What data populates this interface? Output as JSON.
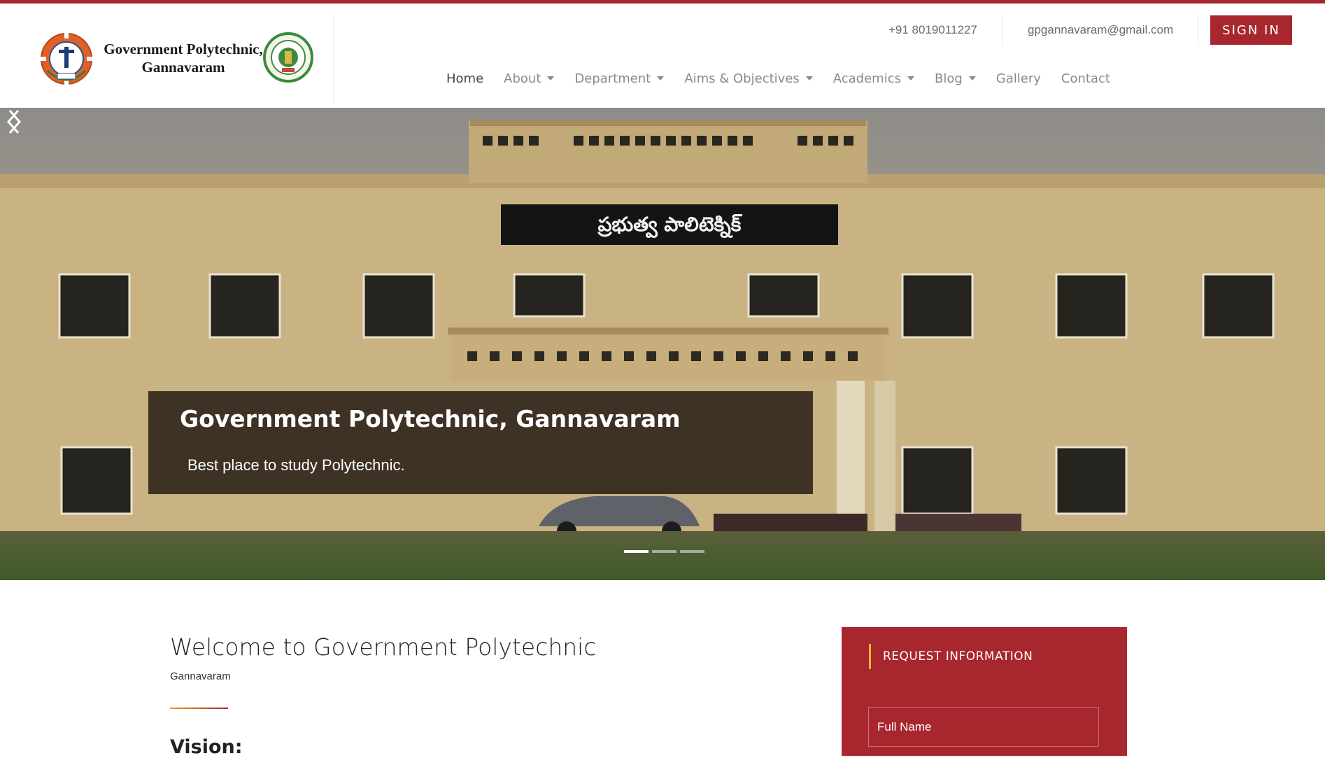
{
  "header": {
    "logo_text_line1": "Government Polytechnic,",
    "logo_text_line2": "Gannavaram",
    "phone": "+91 8019011227",
    "email": "gpgannavaram@gmail.com",
    "signin_label": "SIGN IN"
  },
  "nav": {
    "items": [
      {
        "label": "Home",
        "dropdown": false,
        "active": true
      },
      {
        "label": "About",
        "dropdown": true
      },
      {
        "label": "Department",
        "dropdown": true
      },
      {
        "label": "Aims & Objectives",
        "dropdown": true
      },
      {
        "label": "Academics",
        "dropdown": true
      },
      {
        "label": "Blog",
        "dropdown": true
      },
      {
        "label": "Gallery",
        "dropdown": false
      },
      {
        "label": "Contact",
        "dropdown": false
      }
    ]
  },
  "hero": {
    "building_sign": "ప్రభుత్వ పాలిటెక్నిక్",
    "caption_title": "Government Polytechnic, Gannavaram",
    "caption_subtitle": "Best place to study Polytechnic.",
    "slides_count": 3,
    "active_slide": 1
  },
  "main": {
    "welcome_title": "Welcome to Government Polytechnic",
    "welcome_subtitle": "Gannavaram",
    "vision_heading": "Vision:"
  },
  "request": {
    "title": "REQUEST INFORMATION",
    "full_name_placeholder": "Full Name"
  },
  "colors": {
    "brand": "#a8262d",
    "accent": "#f2b632"
  }
}
